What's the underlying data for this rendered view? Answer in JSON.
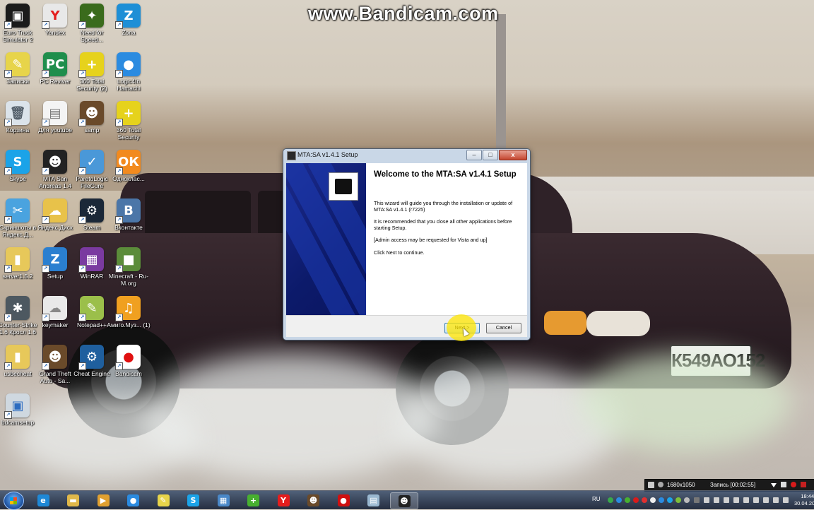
{
  "watermark": "www.Bandicam.com",
  "desktop_icons": [
    {
      "label": "Euro Truck Simulator 2",
      "color": "#1b1b1b",
      "glyph": "▣",
      "icon": "truck-icon"
    },
    {
      "label": "Yandex",
      "color": "#e8e8e8",
      "glyph": "Y",
      "icon": "yandex-browser-icon",
      "fg": "#e41d1d"
    },
    {
      "label": "Need for Speed...",
      "color": "#3a6b1c",
      "glyph": "✦",
      "icon": "nfs-icon"
    },
    {
      "label": "Zona",
      "color": "#1e8fd6",
      "glyph": "Z",
      "icon": "zona-icon"
    },
    {
      "label": "Записки",
      "color": "#e7d44a",
      "glyph": "✎",
      "icon": "notes-icon"
    },
    {
      "label": "PC Reviver",
      "color": "#1f8e4c",
      "glyph": "PC",
      "icon": "pc-reviver-icon"
    },
    {
      "label": "360 Total Security (2)",
      "color": "#e6d21c",
      "glyph": "+",
      "icon": "360-security-icon"
    },
    {
      "label": "Logic4In Hamachi",
      "color": "#2b8be0",
      "glyph": "●",
      "icon": "hamachi-icon"
    },
    {
      "label": "Корзина",
      "color": "#dbe3ea",
      "glyph": "🗑",
      "icon": "recycle-bin-icon",
      "fg": "#55606b"
    },
    {
      "label": "Для youtube",
      "color": "#f4f4f4",
      "glyph": "▤",
      "icon": "text-file-icon",
      "fg": "#777"
    },
    {
      "label": "samp",
      "color": "#6a4a2a",
      "glyph": "☻",
      "icon": "samp-icon"
    },
    {
      "label": "360 Total Security",
      "color": "#e6d21c",
      "glyph": "+",
      "icon": "360-security-icon"
    },
    {
      "label": "Skype",
      "color": "#1ba3e8",
      "glyph": "S",
      "icon": "skype-icon"
    },
    {
      "label": "MTA San Andreas 1.4",
      "color": "#222",
      "glyph": "☻",
      "icon": "mta-icon"
    },
    {
      "label": "ParetoLogic FileCure",
      "color": "#4a98d8",
      "glyph": "✓",
      "icon": "filecure-icon"
    },
    {
      "label": "Одноклас...",
      "color": "#f28a1e",
      "glyph": "ОК",
      "icon": "odnoklassniki-icon"
    },
    {
      "label": "Скриншоты в Яндекс.Д...",
      "color": "#4aa3df",
      "glyph": "✂",
      "icon": "screenshot-icon"
    },
    {
      "label": "Яндекс.Диск",
      "color": "#e8c24a",
      "glyph": "☁",
      "icon": "yandex-disk-icon"
    },
    {
      "label": "Steam",
      "color": "#1b2838",
      "glyph": "⚙",
      "icon": "steam-icon"
    },
    {
      "label": "Вконтакте",
      "color": "#4b76a8",
      "glyph": "В",
      "icon": "vk-icon"
    },
    {
      "label": "server1.5.2",
      "color": "#e7c85a",
      "glyph": "▮",
      "icon": "folder-icon"
    },
    {
      "label": "Setup",
      "color": "#2a7fd0",
      "glyph": "Z",
      "icon": "setup-icon"
    },
    {
      "label": "WinRAR",
      "color": "#7a3aa0",
      "glyph": "▦",
      "icon": "winrar-icon"
    },
    {
      "label": "Minecraft - Ru-M.org",
      "color": "#5b8c3a",
      "glyph": "■",
      "icon": "minecraft-icon"
    },
    {
      "label": "Counter-Strike 1.6 Кросл 1.6",
      "color": "#4d5860",
      "glyph": "✱",
      "icon": "counter-strike-icon"
    },
    {
      "label": "keymaker",
      "color": "#e9e9e9",
      "glyph": "☁",
      "icon": "keymaker-icon",
      "fg": "#888"
    },
    {
      "label": "Notepad++",
      "color": "#9bbf4a",
      "glyph": "✎",
      "icon": "notepad-plus-icon"
    },
    {
      "label": "Амиго.Муз... (1)",
      "color": "#f0a020",
      "glyph": "♫",
      "icon": "amigo-music-icon"
    },
    {
      "label": "usbecheat",
      "color": "#e7c85a",
      "glyph": "▮",
      "icon": "folder-icon"
    },
    {
      "label": "Grand Theft Auto - Sa...",
      "color": "#6a4a2a",
      "glyph": "☻",
      "icon": "gta-icon"
    },
    {
      "label": "Cheat Engine",
      "color": "#1f5f9e",
      "glyph": "⚙",
      "icon": "cheat-engine-icon"
    },
    {
      "label": "Bandicam",
      "color": "#ffffff",
      "glyph": "●",
      "icon": "bandicam-icon",
      "fg": "#e01010"
    },
    {
      "label": "bdcamsetup",
      "color": "#cfd8e0",
      "glyph": "▣",
      "icon": "installer-icon",
      "fg": "#2c6cc0"
    }
  ],
  "dialog": {
    "title": "MTA:SA v1.4.1 Setup",
    "minimize": "–",
    "maximize": "□",
    "close": "x",
    "heading": "Welcome to the MTA:SA v1.4.1 Setup",
    "paragraphs": [
      "This wizard will guide you through the installation or update of MTA:SA v1.4.1 (r7225)",
      "It is recommended that you close all other applications before starting Setup.",
      "[Admin access may be requested for Vista and up]",
      "Click Next to continue."
    ],
    "next_label": "Next >",
    "cancel_label": "Cancel"
  },
  "bandicam_bar": {
    "resolution": "1680x1050",
    "recording": "Запись [00:02:55]"
  },
  "taskbar": {
    "apps": [
      {
        "name": "ie",
        "glyph": "e",
        "color": "#1e88d6"
      },
      {
        "name": "explorer",
        "glyph": "▬",
        "color": "#e0b84a"
      },
      {
        "name": "media-player",
        "glyph": "▶",
        "color": "#e0a030"
      },
      {
        "name": "hamachi",
        "glyph": "●",
        "color": "#2b8be0"
      },
      {
        "name": "notes",
        "glyph": "✎",
        "color": "#e7d44a"
      },
      {
        "name": "skype",
        "glyph": "S",
        "color": "#1ba3e8"
      },
      {
        "name": "control-panel",
        "glyph": "▦",
        "color": "#4a88c8"
      },
      {
        "name": "360-security",
        "glyph": "+",
        "color": "#48b030"
      },
      {
        "name": "yandex",
        "glyph": "Y",
        "color": "#e41d1d"
      },
      {
        "name": "samp",
        "glyph": "☻",
        "color": "#6a4a2a"
      },
      {
        "name": "bandicam",
        "glyph": "●",
        "color": "#d01010"
      },
      {
        "name": "file",
        "glyph": "▤",
        "color": "#9ab8d0"
      },
      {
        "name": "mta-setup",
        "glyph": "☻",
        "color": "#222"
      }
    ],
    "language": "RU",
    "time": "18:44",
    "date": "30.04.2015"
  }
}
